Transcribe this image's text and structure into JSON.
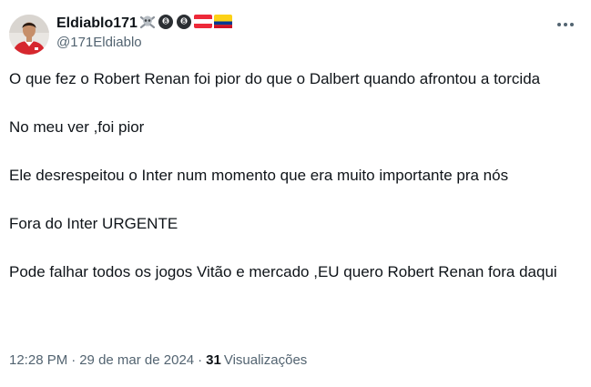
{
  "author": {
    "display_name": "Eldiablo171",
    "handle": "@171Eldiablo",
    "name_emoji": [
      "skull-crossbones",
      "8-ball",
      "8-ball",
      "austria-flag",
      "colombia-flag"
    ]
  },
  "menu_icon": "more-horizontal-icon",
  "tweet": {
    "paragraphs": [
      "O que fez o Robert Renan foi pior do que o Dalbert quando afrontou a torcida",
      "No meu ver ,foi pior",
      "Ele desrespeitou o Inter num momento que era muito importante pra nós",
      "Fora do Inter URGENTE",
      "Pode falhar todos os jogos Vitão e mercado ,EU quero Robert Renan fora daqui"
    ]
  },
  "meta": {
    "time": "12:28 PM",
    "separator": "·",
    "date": "29 de mar de 2024",
    "views_count": "31",
    "views_label": "Visualizações"
  },
  "colors": {
    "text": "#0f1419",
    "secondary": "#536471",
    "jersey": "#d6272e",
    "austria_red": "#ed2939",
    "colombia_yellow": "#fcd116",
    "colombia_blue": "#003893",
    "colombia_red": "#ce1126"
  }
}
